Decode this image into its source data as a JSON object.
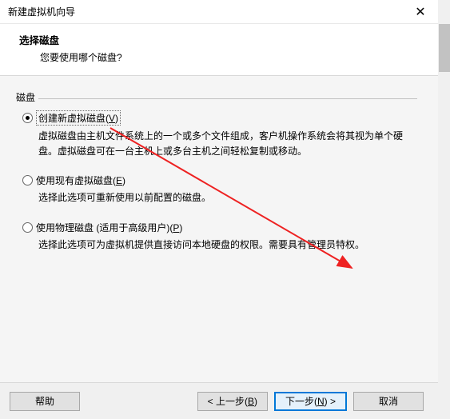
{
  "titlebar": {
    "title": "新建虚拟机向导"
  },
  "header": {
    "title": "选择磁盘",
    "subtitle": "您要使用哪个磁盘?"
  },
  "section": {
    "legend": "磁盘"
  },
  "options": [
    {
      "label_pre": "创建新虚拟磁盘(",
      "label_key": "V",
      "label_post": ")",
      "checked": true,
      "desc": "虚拟磁盘由主机文件系统上的一个或多个文件组成，客户机操作系统会将其视为单个硬盘。虚拟磁盘可在一台主机上或多台主机之间轻松复制或移动。"
    },
    {
      "label_pre": "使用现有虚拟磁盘(",
      "label_key": "E",
      "label_post": ")",
      "checked": false,
      "desc": "选择此选项可重新使用以前配置的磁盘。"
    },
    {
      "label_pre": "使用物理磁盘 (适用于高级用户)(",
      "label_key": "P",
      "label_post": ")",
      "checked": false,
      "desc": "选择此选项可为虚拟机提供直接访问本地硬盘的权限。需要具有管理员特权。"
    }
  ],
  "footer": {
    "help": "帮助",
    "back_pre": "< 上一步(",
    "back_key": "B",
    "back_post": ")",
    "next_pre": "下一步(",
    "next_key": "N",
    "next_post": ") >",
    "cancel": "取消"
  }
}
